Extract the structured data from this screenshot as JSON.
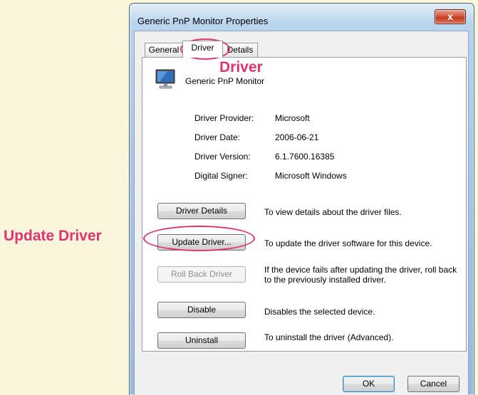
{
  "window": {
    "title": "Generic PnP Monitor Properties",
    "close_glyph": "x"
  },
  "tabs": [
    {
      "label": "General"
    },
    {
      "label": "Driver"
    },
    {
      "label": "Details"
    }
  ],
  "device": {
    "icon": "monitor-icon",
    "name": "Generic PnP Monitor"
  },
  "properties": [
    {
      "label": "Driver Provider:",
      "value": "Microsoft"
    },
    {
      "label": "Driver Date:",
      "value": "2006-06-21"
    },
    {
      "label": "Driver Version:",
      "value": "6.1.7600.16385"
    },
    {
      "label": "Digital Signer:",
      "value": "Microsoft Windows"
    }
  ],
  "actions": [
    {
      "label": "Driver Details",
      "description": "To view details about the driver files.",
      "enabled": true
    },
    {
      "label": "Update Driver...",
      "description": "To update the driver software for this device.",
      "enabled": true
    },
    {
      "label": "Roll Back Driver",
      "description": "If the device fails after updating the driver, roll back to the previously installed driver.",
      "enabled": false
    },
    {
      "label": "Disable",
      "description": "Disables the selected device.",
      "enabled": true
    },
    {
      "label": "Uninstall",
      "description": "To uninstall the driver (Advanced).",
      "enabled": true
    }
  ],
  "footer": {
    "ok_label": "OK",
    "cancel_label": "Cancel"
  },
  "annotations": {
    "driver_callout": "Driver",
    "update_callout": "Update Driver",
    "color": "#e0336f"
  }
}
